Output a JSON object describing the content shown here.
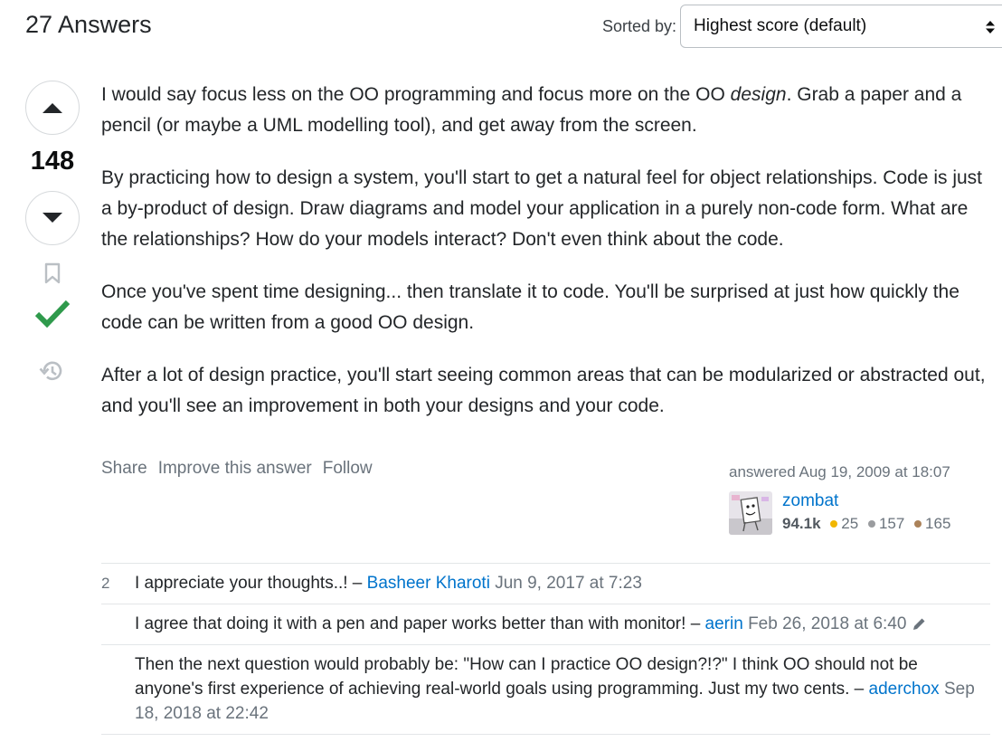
{
  "header": {
    "answers_count": "27 Answers",
    "sort_label": "Sorted by:",
    "sort_value": "Highest score (default)"
  },
  "vote": {
    "score": "148",
    "up_icon": "arrow-up-icon",
    "down_icon": "arrow-down-icon",
    "bookmark_icon": "bookmark-icon",
    "accepted_icon": "checkmark-icon",
    "history_icon": "history-icon",
    "accepted_color": "#2f9a4c"
  },
  "answer": {
    "p1_a": "I would say focus less on the OO programming and focus more on the OO ",
    "p1_em": "design",
    "p1_b": ". Grab a paper and a pencil (or maybe a UML modelling tool), and get away from the screen.",
    "p2": "By practicing how to design a system, you'll start to get a natural feel for object relationships. Code is just a by-product of design. Draw diagrams and model your application in a purely non-code form. What are the relationships? How do your models interact? Don't even think about the code.",
    "p3": "Once you've spent time designing... then translate it to code. You'll be surprised at just how quickly the code can be written from a good OO design.",
    "p4": "After a lot of design practice, you'll start seeing common areas that can be modularized or abstracted out, and you'll see an improvement in both your designs and your code."
  },
  "menu": {
    "share": "Share",
    "improve": "Improve this answer",
    "follow": "Follow"
  },
  "user": {
    "answered": "answered Aug 19, 2009 at 18:07",
    "name": "zombat",
    "rep": "94.1k",
    "gold": "25",
    "silver": "157",
    "bronze": "165",
    "gold_color": "#f1b600",
    "silver_color": "#9a9c9f",
    "bronze_color": "#ab8259"
  },
  "comments": [
    {
      "score": "2",
      "text": "I appreciate your thoughts..! – ",
      "user": "Basheer Kharoti",
      "date": "Jun 9, 2017 at 7:23"
    },
    {
      "score": "",
      "text": "I agree that doing it with a pen and paper works better than with monitor! – ",
      "user": "aerin",
      "date": "Feb 26, 2018 at 6:40",
      "edit_icon": "pencil-icon"
    },
    {
      "score": "",
      "text": "Then the next question would probably be: \"How can I practice OO design?!?\" I think OO should not be anyone's first experience of achieving real-world goals using programming. Just my two cents. – ",
      "user": "aderchox",
      "date": "Sep 18, 2018 at 22:42"
    }
  ]
}
